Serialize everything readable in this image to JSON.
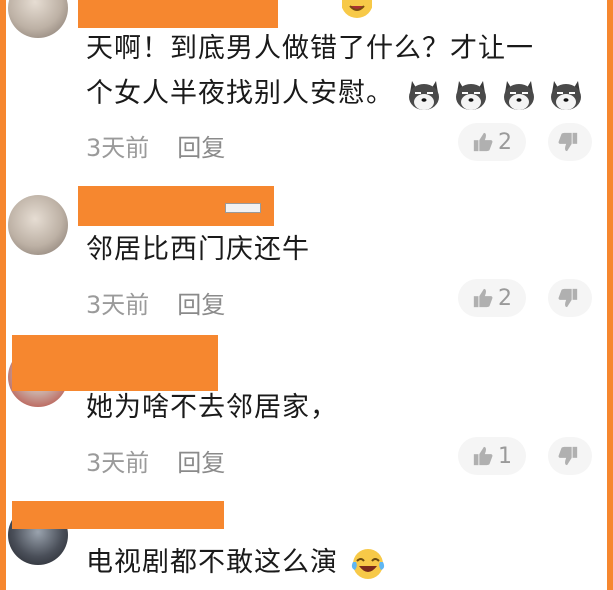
{
  "comments": [
    {
      "text_line1": "天啊！到底男人做错了什么？才让一",
      "text_line2": "个女人半夜找别人安慰。",
      "emoji": [
        "doge-emoji",
        "doge-emoji",
        "doge-emoji",
        "doge-emoji"
      ],
      "time": "3天前",
      "reply_label": "回复",
      "likes": "2"
    },
    {
      "text_line1": "邻居比西门庆还牛",
      "time": "3天前",
      "reply_label": "回复",
      "likes": "2"
    },
    {
      "text_line1": "她为啥不去邻居家，",
      "time": "3天前",
      "reply_label": "回复",
      "likes": "1"
    },
    {
      "text_line1": "电视剧都不敢这么演",
      "emoji": [
        "laughing-crying-emoji"
      ]
    }
  ],
  "colors": {
    "redaction": "#f6872f",
    "meta_text": "#9a9a9a",
    "pill_bg": "#f5f5f5"
  },
  "icons": {
    "like": "thumbs-up-icon",
    "dislike": "thumbs-down-icon"
  }
}
